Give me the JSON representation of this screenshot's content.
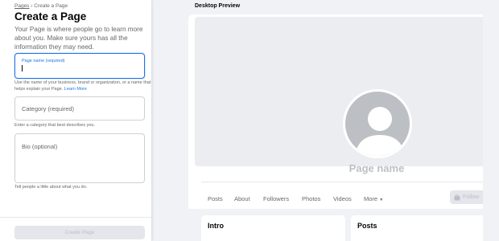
{
  "breadcrumb": {
    "root": "Pages",
    "sep": "›",
    "current": "Create a Page"
  },
  "form": {
    "title": "Create a Page",
    "description": "Your Page is where people go to learn more about you. Make sure yours has all the information they may need.",
    "page_name": {
      "label": "Page name (required)",
      "value": ""
    },
    "page_name_hint": "Use the name of your business, brand or organization, or a name that helps explain your Page.",
    "learn_more": "Learn More",
    "category": {
      "placeholder": "Category (required)"
    },
    "category_hint": "Enter a category that best describes you.",
    "bio": {
      "placeholder": "Bio (optional)"
    },
    "bio_hint": "Tell people a little about what you do.",
    "create_button": "Create Page"
  },
  "preview": {
    "label": "Desktop Preview",
    "page_name": "Page name",
    "tabs": [
      "Posts",
      "About",
      "Followers",
      "Photos",
      "Videos",
      "More"
    ],
    "follow_button": "Follow",
    "cards": {
      "intro": "Intro",
      "posts": "Posts"
    }
  },
  "colors": {
    "accent": "#1b74e4",
    "muted": "#65676b",
    "disabled": "#bcc0c4"
  }
}
